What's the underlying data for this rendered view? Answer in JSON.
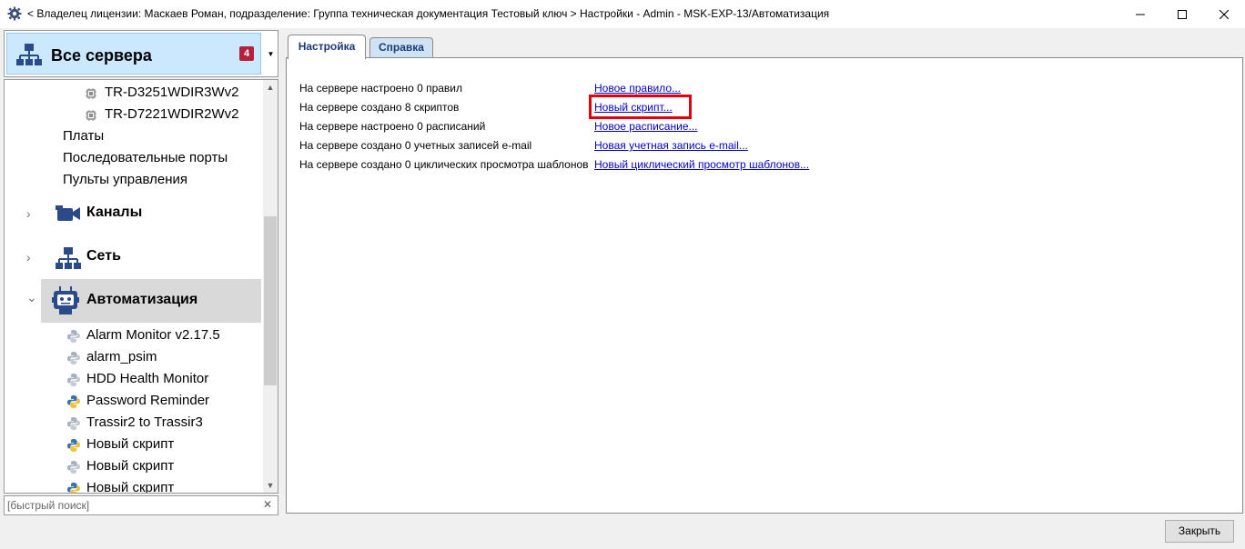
{
  "window": {
    "title": "< Владелец лицензии: Маскаев Роман, подразделение: Группа техническая документация Тестовый ключ > Настройки - Admin - MSK-EXP-13/Автоматизация",
    "min_glyph": "—",
    "max_glyph": "☐",
    "close_glyph": "✕"
  },
  "server_selector": {
    "title": "Все сервера",
    "badge": "4",
    "icon": "network-icon",
    "dropdown_glyph": "▼"
  },
  "tree": {
    "devices": [
      {
        "label": "TR-D3251WDIR3Wv2",
        "icon": "chip-icon"
      },
      {
        "label": "TR-D7221WDIR2Wv2",
        "icon": "chip-icon"
      }
    ],
    "plain_items": [
      "Платы",
      "Последовательные порты",
      "Пульты управления"
    ],
    "sections": [
      {
        "label": "Каналы",
        "icon": "camera-icon",
        "chevron": "›"
      },
      {
        "label": "Сеть",
        "icon": "network-icon",
        "chevron": "›"
      },
      {
        "label": "Автоматизация",
        "icon": "robot-icon",
        "chevron": "⌄"
      }
    ],
    "scripts": [
      {
        "label": "Alarm Monitor v2.17.5",
        "active": false
      },
      {
        "label": "alarm_psim",
        "active": false
      },
      {
        "label": "HDD Health Monitor",
        "active": false
      },
      {
        "label": "Password Reminder",
        "active": true
      },
      {
        "label": "Trassir2 to Trassir3",
        "active": false
      },
      {
        "label": "Новый скрипт",
        "active": true
      },
      {
        "label": "Новый скрипт",
        "active": false
      },
      {
        "label": "Новый скрипт",
        "active": true
      }
    ],
    "scroll_up": "▲",
    "scroll_down": "▼"
  },
  "search": {
    "placeholder": "[быстрый поиск]",
    "value": "",
    "clear_glyph": "✕"
  },
  "tabs": [
    {
      "label": "Настройка",
      "active": true
    },
    {
      "label": "Справка",
      "active": false
    }
  ],
  "automation": {
    "rows": [
      {
        "text": "На сервере настроено 0 правил",
        "link": "Новое правило..."
      },
      {
        "text": "На сервере создано 8 скриптов",
        "link": "Новый скрипт..."
      },
      {
        "text": "На сервере настроено 0 расписаний",
        "link": "Новое расписание..."
      },
      {
        "text": "На сервере создано 0 учетных записей e-mail",
        "link": "Новая учетная запись e-mail..."
      },
      {
        "text": "На сервере создано 0 циклических просмотра шаблонов",
        "link": "Новый циклический просмотр шаблонов..."
      }
    ],
    "highlight_color": "#e5000f"
  },
  "footer": {
    "close_label": "Закрыть"
  }
}
